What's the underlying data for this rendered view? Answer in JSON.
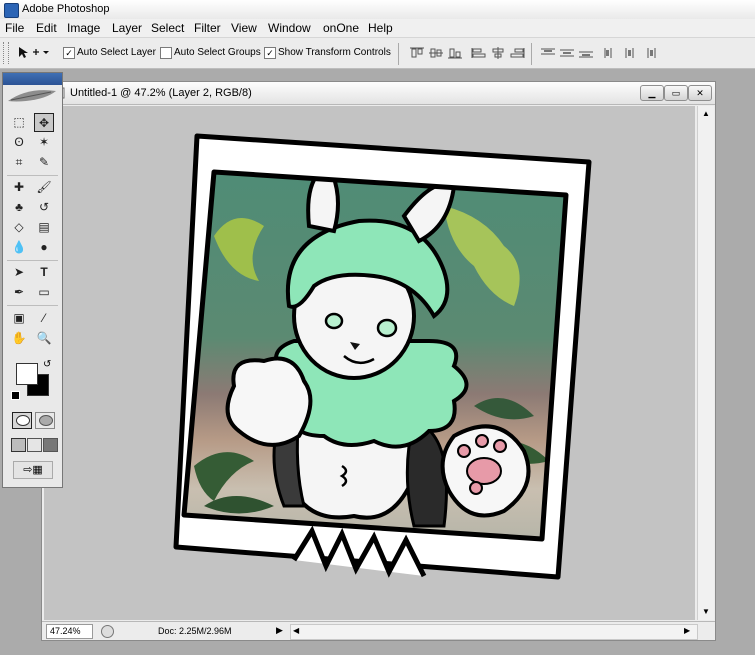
{
  "app": {
    "title": "Adobe Photoshop"
  },
  "menu": [
    "File",
    "Edit",
    "Image",
    "Layer",
    "Select",
    "Filter",
    "View",
    "Window",
    "onOne",
    "Help"
  ],
  "options_bar": {
    "auto_select_layer": {
      "label": "Auto Select Layer",
      "checked": true
    },
    "auto_select_groups": {
      "label": "Auto Select Groups",
      "checked": false
    },
    "show_transform_controls": {
      "label": "Show Transform Controls",
      "checked": true
    }
  },
  "document": {
    "title": "Untitled-1 @ 47.2% (Layer 2, RGB/8)",
    "zoom": "47.24%",
    "doc_size": "Doc: 2.25M/2.96M"
  },
  "colors": {
    "bg_gray": "#ababab",
    "canvas_gray": "#c3c3c3",
    "mint": "#8ee6b8",
    "mint_dark": "#4aa57c",
    "paw_pink": "#e79aa8",
    "sky_green": "#5b8a72",
    "brown_band": "#8c7a74"
  },
  "icons": {
    "move_tool": "move-tool-icon",
    "marquee_tool": "marquee-tool-icon",
    "lasso_tool": "lasso-tool-icon",
    "magic_wand_tool": "magic-wand-tool-icon",
    "crop_tool": "crop-tool-icon",
    "slice_tool": "slice-tool-icon",
    "healing_brush_tool": "healing-brush-tool-icon",
    "brush_tool": "brush-tool-icon",
    "clone_stamp_tool": "clone-stamp-tool-icon",
    "history_brush_tool": "history-brush-tool-icon",
    "eraser_tool": "eraser-tool-icon",
    "gradient_tool": "gradient-tool-icon",
    "blur_tool": "blur-tool-icon",
    "dodge_tool": "dodge-tool-icon",
    "path_selection_tool": "path-selection-tool-icon",
    "type_tool": "type-tool-icon",
    "pen_tool": "pen-tool-icon",
    "shape_tool": "shape-tool-icon",
    "notes_tool": "notes-tool-icon",
    "eyedropper_tool": "eyedropper-tool-icon",
    "hand_tool": "hand-tool-icon",
    "zoom_tool": "zoom-tool-icon"
  }
}
